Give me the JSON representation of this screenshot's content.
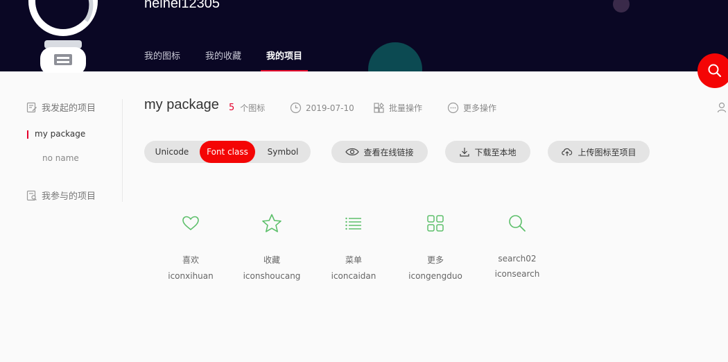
{
  "user": {
    "name": "heihei12305"
  },
  "hero_tabs": [
    {
      "label": "我的图标"
    },
    {
      "label": "我的收藏"
    },
    {
      "label": "我的项目"
    }
  ],
  "sidebar": {
    "created_heading": "我发起的项目",
    "joined_heading": "我参与的项目",
    "projects": [
      {
        "label": "my package"
      },
      {
        "label": "no name"
      }
    ]
  },
  "project": {
    "title": "my package",
    "icon_count": "5",
    "icon_count_suffix": "个图标",
    "date": "2019-07-10",
    "batch_label": "批量操作",
    "more_label": "更多操作"
  },
  "modes": {
    "unicode": "Unicode",
    "font_class": "Font class",
    "symbol": "Symbol"
  },
  "actions": {
    "view_link": "查看在线链接",
    "download": "下载至本地",
    "upload": "上传图标至项目"
  },
  "icons": [
    {
      "icon": "heart-icon",
      "name": "喜欢",
      "code": "iconxihuan"
    },
    {
      "icon": "star-icon",
      "name": "收藏",
      "code": "iconshoucang"
    },
    {
      "icon": "menu-icon",
      "name": "菜单",
      "code": "iconcaidan"
    },
    {
      "icon": "grid-icon",
      "name": "更多",
      "code": "icongengduo"
    },
    {
      "icon": "search-icon",
      "name": "search02",
      "code": "iconsearch"
    }
  ],
  "colors": {
    "accent": "#f40505",
    "hero_bg": "#0a0724",
    "icon_green": "#5cbf6a"
  }
}
